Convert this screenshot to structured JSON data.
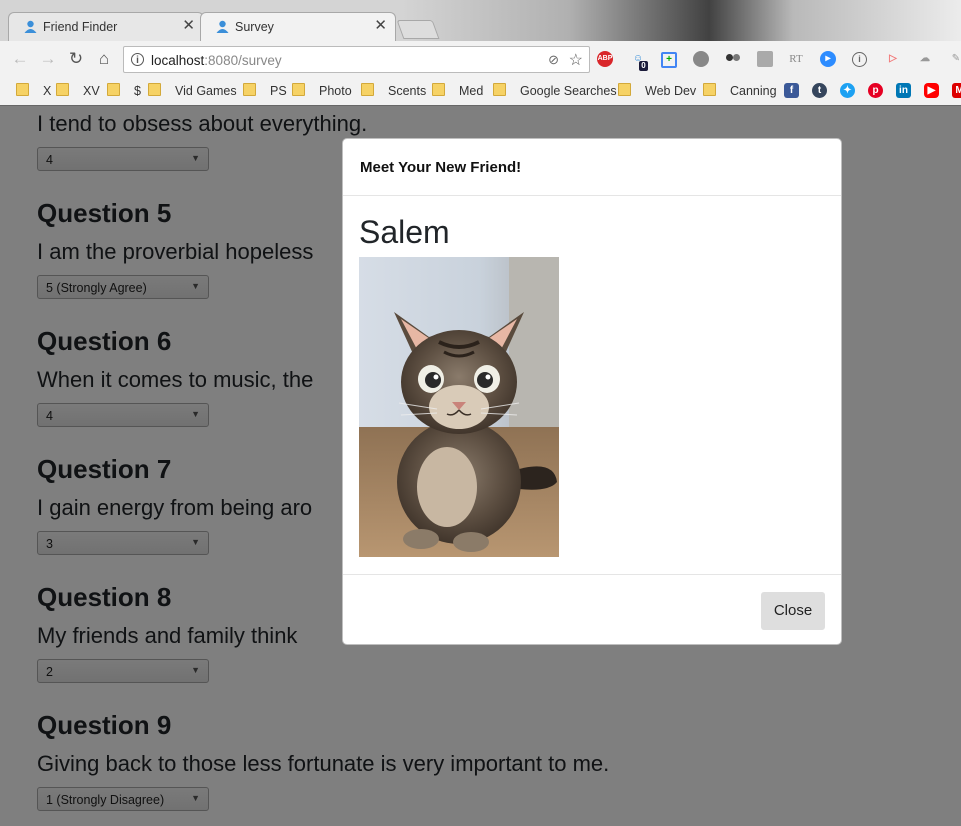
{
  "browser": {
    "tabs": [
      {
        "title": "Friend Finder",
        "active": false
      },
      {
        "title": "Survey",
        "active": true
      }
    ],
    "url_host": "localhost",
    "url_path": ":8080/survey",
    "bookmarks": [
      "X",
      "XV",
      "$",
      "Vid Games",
      "PS",
      "Photo",
      "Scents",
      "Med",
      "Google Searches",
      "Web Dev",
      "Canning"
    ],
    "extensions": [
      "ABP",
      "RT"
    ],
    "extension_badge": "0"
  },
  "survey": {
    "q4": {
      "text": "I tend to obsess about everything.",
      "value": "4"
    },
    "q5": {
      "title": "Question 5",
      "text": "I am the proverbial hopeless",
      "value": "5 (Strongly Agree)"
    },
    "q6": {
      "title": "Question 6",
      "text": "When it comes to music, the",
      "value": "4"
    },
    "q7": {
      "title": "Question 7",
      "text": "I gain energy from being aro",
      "value": "3"
    },
    "q8": {
      "title": "Question 8",
      "text": "My friends and family think",
      "value": "2"
    },
    "q9": {
      "title": "Question 9",
      "text": "Giving back to those less fortunate is very important to me.",
      "value": "1 (Strongly Disagree)"
    }
  },
  "modal": {
    "title": "Meet Your New Friend!",
    "friend_name": "Salem",
    "photo_subject": "tabby kitten",
    "close_label": "Close"
  }
}
